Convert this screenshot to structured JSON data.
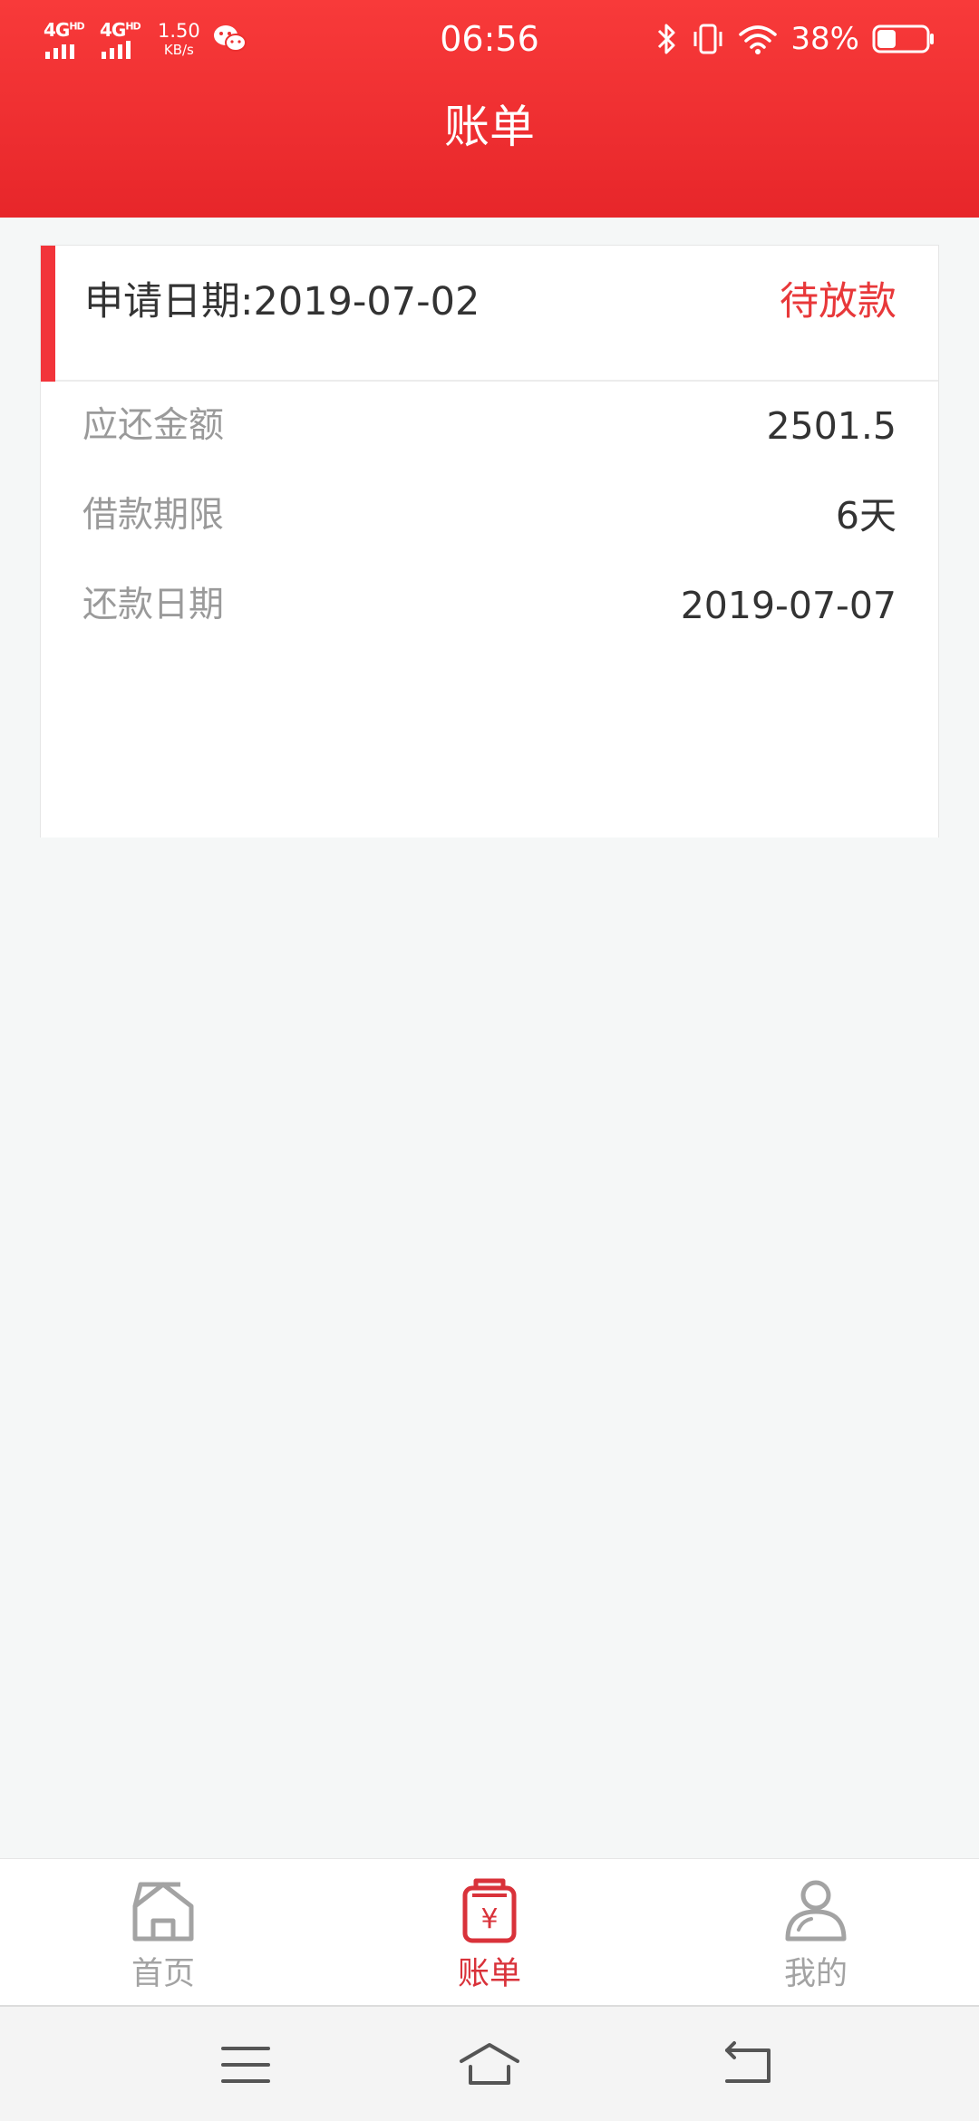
{
  "status_bar": {
    "network_1": "4G",
    "network_1_hd": "HD",
    "network_2": "4G",
    "network_2_hd": "HD",
    "speed_value": "1.50",
    "speed_unit": "KB/s",
    "time": "06:56",
    "battery_percent": "38%",
    "battery_level": 0.38,
    "icons": [
      "signal-icon",
      "wechat-icon",
      "bluetooth-icon",
      "vibrate-icon",
      "wifi-icon",
      "battery-icon"
    ]
  },
  "header": {
    "title": "账单"
  },
  "bill": {
    "apply_date_label": "申请日期:",
    "apply_date": "2019-07-02",
    "apply_date_full": "申请日期:2019-07-02",
    "status": "待放款",
    "rows": [
      {
        "label": "应还金额",
        "value": "2501.5"
      },
      {
        "label": "借款期限",
        "value": "6天"
      },
      {
        "label": "还款日期",
        "value": "2019-07-07"
      }
    ]
  },
  "bottom_nav": {
    "items": [
      {
        "label": "首页",
        "icon": "home-icon",
        "active": false
      },
      {
        "label": "账单",
        "icon": "bill-icon",
        "active": true
      },
      {
        "label": "我的",
        "icon": "user-icon",
        "active": false
      }
    ]
  },
  "system_nav": {
    "icons": [
      "menu-icon",
      "home-nav-icon",
      "back-icon"
    ]
  },
  "colors": {
    "brand_red": "#e7262a",
    "accent_red": "#f2343a",
    "status_red": "#e8383a",
    "label_gray": "#9a9a9a",
    "value_dark": "#333333",
    "nav_inactive": "#a3a3a3",
    "background": "#f5f7f7"
  }
}
